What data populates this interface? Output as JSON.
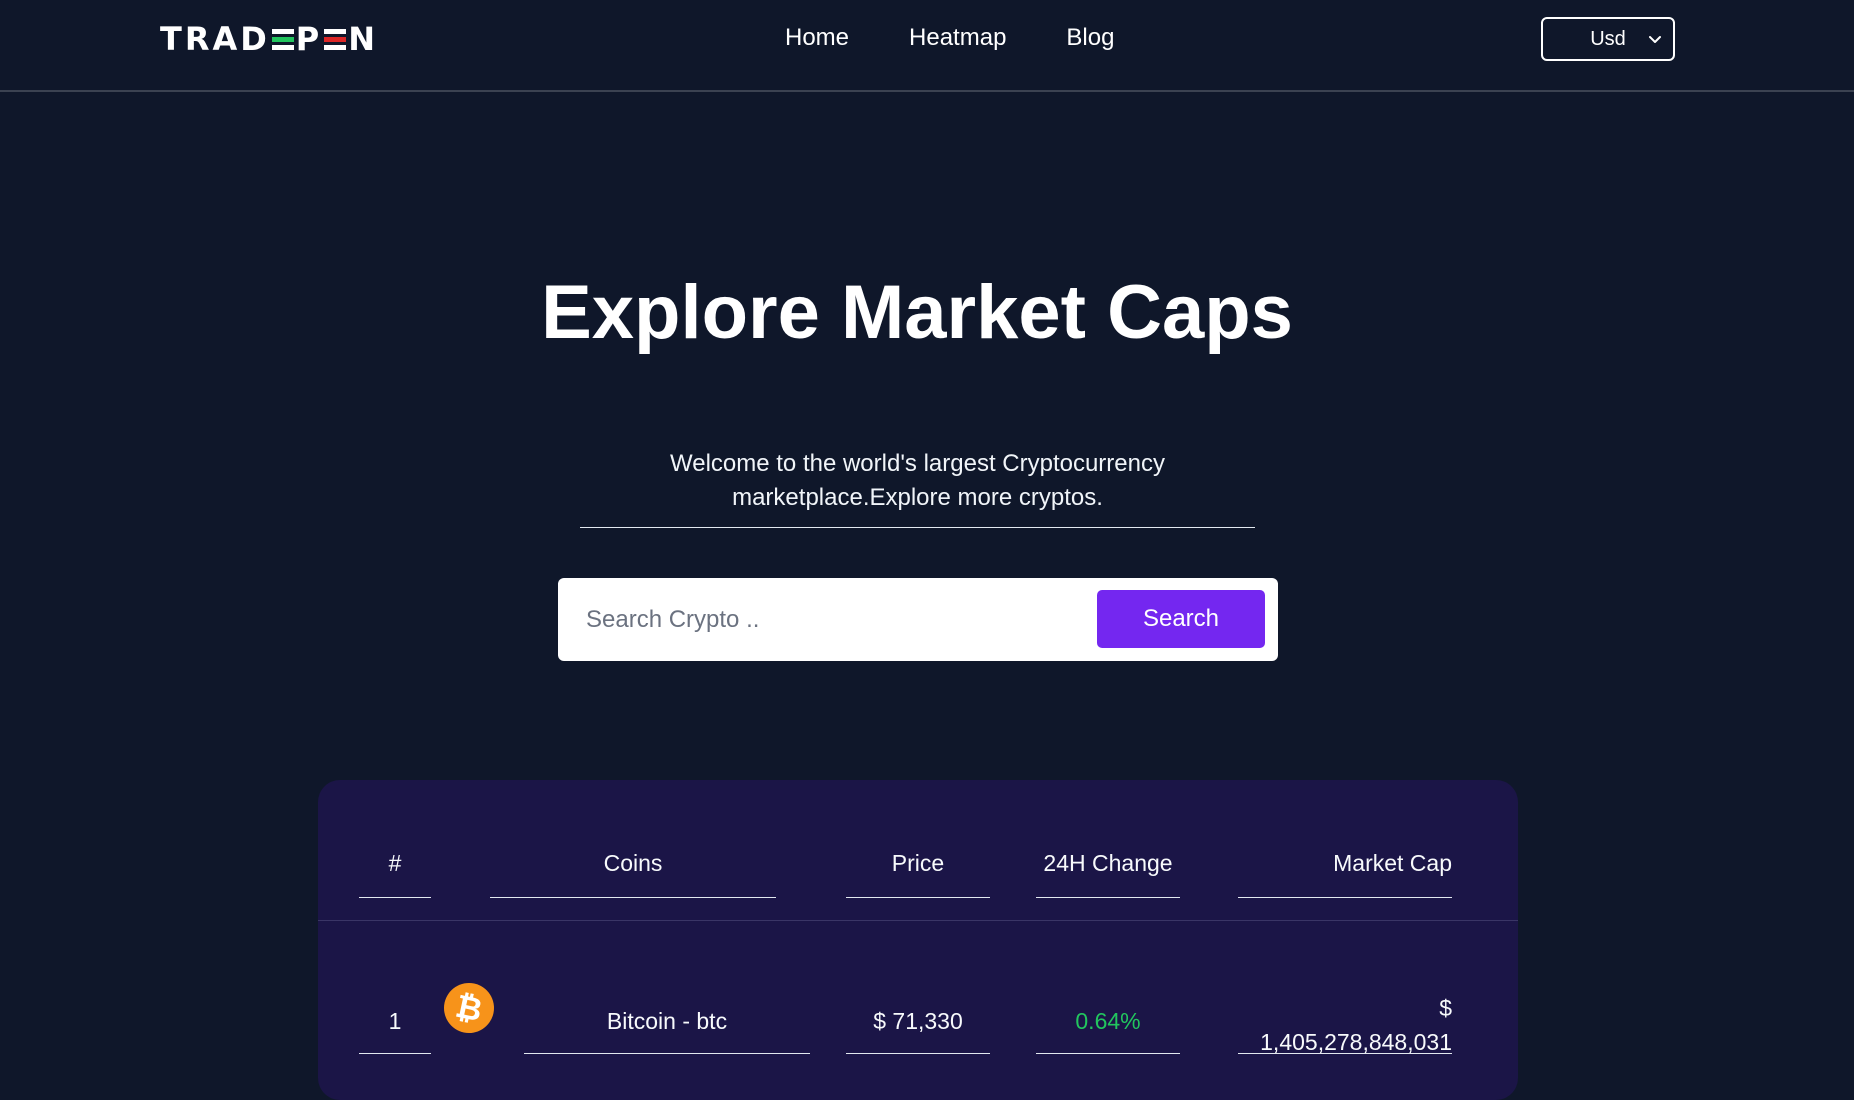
{
  "brand": {
    "logo_start": "TRAD",
    "logo_end": "P",
    "logo_tail": "N",
    "logo_colors": {
      "green": "#22c55e",
      "white": "#ffffff",
      "red": "#dc2626"
    }
  },
  "nav": {
    "links": [
      "Home",
      "Heatmap",
      "Blog"
    ]
  },
  "currency": {
    "selected": "Usd",
    "icon": "chevron-down-icon"
  },
  "hero": {
    "title": "Explore Market Caps",
    "subtitle_line1": "Welcome to the world's largest Cryptocurrency",
    "subtitle_line2": "marketplace.Explore more cryptos."
  },
  "search": {
    "placeholder": "Search Crypto ..",
    "button_label": "Search",
    "button_color": "#7427f0"
  },
  "table": {
    "headers": [
      "#",
      "Coins",
      "Price",
      "24H Change",
      "Market Cap"
    ],
    "rows": [
      {
        "rank": "1",
        "icon": "bitcoin-icon",
        "coin": "Bitcoin - btc",
        "price": "$ 71,330",
        "change": "0.64%",
        "change_color": "#22c55e",
        "market_cap_symbol": "$",
        "market_cap_value": "1,405,278,848,031"
      }
    ]
  },
  "colors": {
    "background": "#0f172a",
    "card": "#1b1547",
    "accent": "#7427f0"
  }
}
